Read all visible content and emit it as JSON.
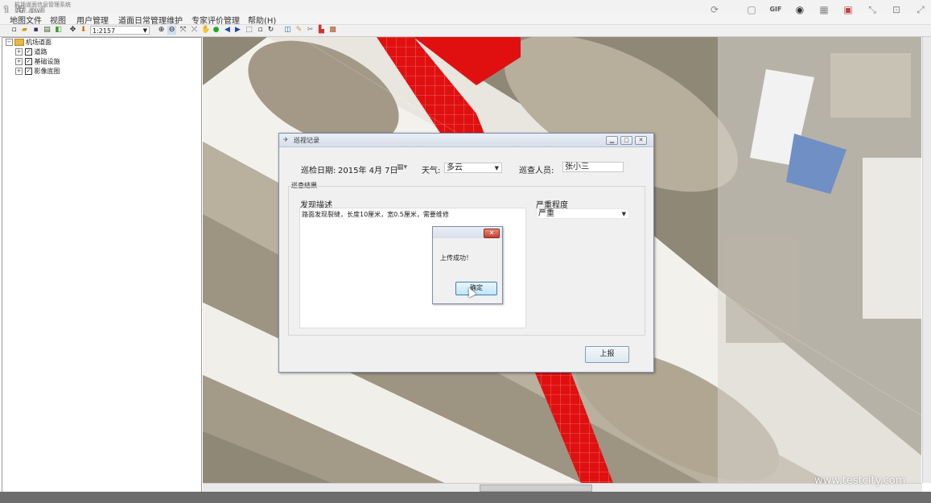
{
  "window": {
    "video_title": "1_转.avi",
    "app_title": "机场道面信息管理系统"
  },
  "menubar": {
    "items": [
      "地图文件",
      "视图",
      "用户管理",
      "道面日常管理维护",
      "专家评价管理",
      "帮助(H)"
    ]
  },
  "recorder_tools": [
    "refresh-icon",
    "square-icon",
    "gif-icon",
    "record-icon",
    "grid-icon",
    "palette-icon",
    "arrows-icon",
    "crop-icon",
    "fullscreen-icon"
  ],
  "recorder_labels": {
    "gif": "GIF"
  },
  "toolbar": {
    "scale": "1:2157"
  },
  "tree": {
    "root": "机场道面",
    "items": [
      "道路",
      "基础设施",
      "影像底图"
    ]
  },
  "map": {
    "colors": {
      "runway": "#f5f3ef",
      "tarmac": "#c8c1b3",
      "grass": "#8c8675",
      "highlight": "#e01010",
      "hangar_blue": "#6f8fc5"
    }
  },
  "dialog": {
    "title": "巡视记录",
    "date_label": "巡检日期:",
    "date_value": "2015年  4月  7日",
    "weather_label": "天气:",
    "weather_value": "多云",
    "inspector_label": "巡查人员:",
    "inspector_value": "张小三",
    "group_label": "巡查结果",
    "desc_label": "发现描述",
    "desc_text": "路面发现裂缝，长度10厘米，宽0.5厘米，需要维修",
    "severity_label": "严重程度",
    "severity_value": "严重",
    "submit_label": "上报"
  },
  "messagebox": {
    "text": "上传成功！",
    "ok_label": "确定"
  },
  "watermark": "www.testcity.com"
}
